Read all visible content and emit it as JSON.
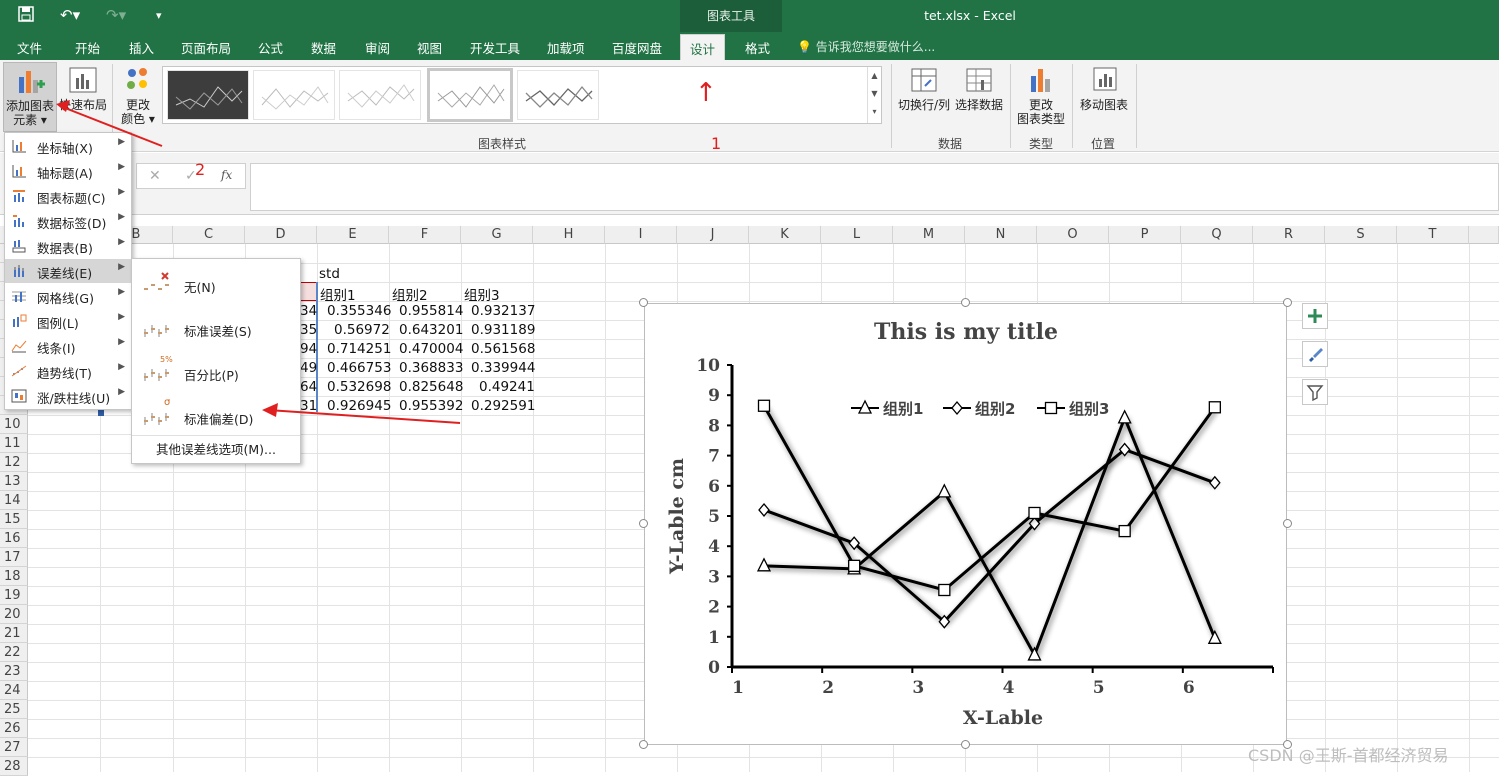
{
  "app": {
    "doc_title": "tet.xlsx  -  Excel",
    "context_group": "图表工具"
  },
  "menu_tabs": [
    "文件",
    "开始",
    "插入",
    "页面布局",
    "公式",
    "数据",
    "审阅",
    "视图",
    "开发工具",
    "加载项",
    "百度网盘",
    "设计",
    "格式"
  ],
  "tell_me": "告诉我您想要做什么...",
  "ribbon": {
    "add_element": {
      "line1": "添加图表",
      "line2": "元素 ▾"
    },
    "quick_layout": "快速布局",
    "change_color": {
      "line1": "更改",
      "line2": "颜色 ▾"
    },
    "styles_group": "图表样式",
    "switch_rowcol": "切换行/列",
    "select_data": "选择数据",
    "data_group": "数据",
    "change_type": {
      "line1": "更改",
      "line2": "图表类型"
    },
    "type_group": "类型",
    "move_chart": "移动图表",
    "location_group": "位置"
  },
  "formula_bar": {
    "cancel": "✕",
    "confirm": "✓",
    "fx": "fx"
  },
  "columns": [
    "B",
    "C",
    "D",
    "E",
    "F",
    "G",
    "H",
    "I",
    "J",
    "K",
    "L",
    "M",
    "N",
    "O",
    "P",
    "Q",
    "R",
    "S",
    "T"
  ],
  "rows": [
    "10",
    "11",
    "12",
    "13",
    "14",
    "15",
    "16",
    "17",
    "18",
    "19",
    "20",
    "21",
    "22",
    "23",
    "24",
    "25",
    "26",
    "27",
    "28"
  ],
  "sheet": {
    "std_label": "std",
    "headers": [
      "组别1",
      "组别2",
      "组别3"
    ],
    "d_partial": [
      "34",
      "35",
      "94",
      "49",
      "64",
      "31"
    ],
    "values": [
      [
        "0.355346",
        "0.955814",
        "0.932137"
      ],
      [
        "0.56972",
        "0.643201",
        "0.931189"
      ],
      [
        "0.714251",
        "0.470004",
        "0.561568"
      ],
      [
        "0.466753",
        "0.368833",
        "0.339944"
      ],
      [
        "0.532698",
        "0.825648",
        "0.49241"
      ],
      [
        "0.926945",
        "0.955392",
        "0.292591"
      ]
    ]
  },
  "add_element_menu": [
    {
      "label": "坐标轴(X)",
      "icon": "axes-icon"
    },
    {
      "label": "轴标题(A)",
      "icon": "axis-title-icon"
    },
    {
      "label": "图表标题(C)",
      "icon": "chart-title-icon"
    },
    {
      "label": "数据标签(D)",
      "icon": "data-labels-icon"
    },
    {
      "label": "数据表(B)",
      "icon": "data-table-icon"
    },
    {
      "label": "误差线(E)",
      "icon": "error-bars-icon"
    },
    {
      "label": "网格线(G)",
      "icon": "gridlines-icon"
    },
    {
      "label": "图例(L)",
      "icon": "legend-icon"
    },
    {
      "label": "线条(I)",
      "icon": "lines-icon"
    },
    {
      "label": "趋势线(T)",
      "icon": "trendline-icon"
    },
    {
      "label": "涨/跌柱线(U)",
      "icon": "updown-bars-icon"
    }
  ],
  "error_bar_menu": {
    "items": [
      {
        "label": "无(N)",
        "icon": "none-error-icon"
      },
      {
        "label": "标准误差(S)",
        "icon": "standard-error-icon"
      },
      {
        "label": "百分比(P)",
        "icon": "percentage-error-icon",
        "badge": "5%"
      },
      {
        "label": "标准偏差(D)",
        "icon": "std-dev-icon",
        "badge": "σ"
      }
    ],
    "more": "其他误差线选项(M)..."
  },
  "annotations": {
    "one": "1",
    "two": "2",
    "up_arrow": "↑"
  },
  "watermark": "CSDN @王斯-首都经济贸易",
  "chart_data": {
    "type": "line",
    "title": "This is my title",
    "xlabel": "X-Lable",
    "ylabel": "Y-Lable  cm",
    "x": [
      1,
      2,
      3,
      4,
      5,
      6
    ],
    "xlim": [
      1,
      7
    ],
    "ylim": [
      0,
      10
    ],
    "yticks": [
      0,
      1,
      2,
      3,
      4,
      5,
      6,
      7,
      8,
      9,
      10
    ],
    "legend_position": "top-center",
    "series": [
      {
        "name": "组别1",
        "marker": "triangle",
        "values": [
          3.35,
          3.25,
          5.8,
          0.4,
          8.25,
          0.95
        ]
      },
      {
        "name": "组别2",
        "marker": "diamond",
        "values": [
          5.2,
          4.1,
          1.5,
          4.75,
          7.2,
          6.1
        ]
      },
      {
        "name": "组别3",
        "marker": "square",
        "values": [
          8.65,
          3.35,
          2.55,
          5.1,
          4.5,
          8.6
        ]
      }
    ]
  }
}
